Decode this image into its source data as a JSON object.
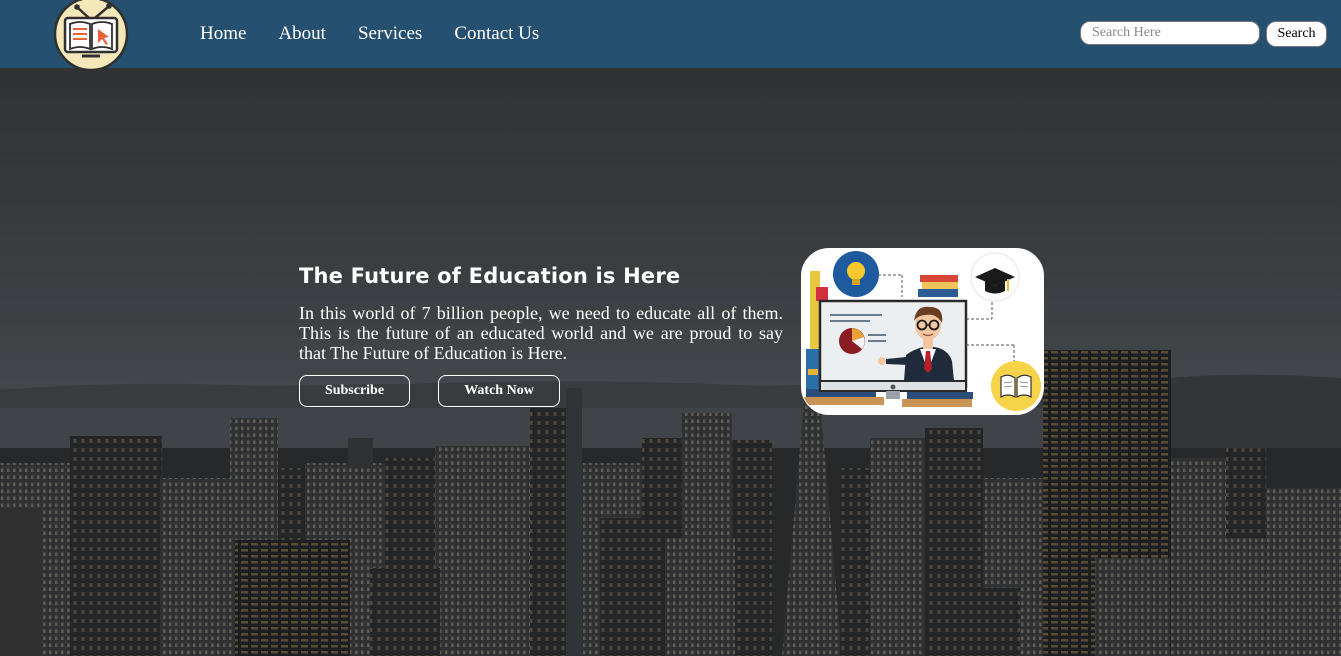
{
  "navbar": {
    "logo_icon": "education-tv-book-icon",
    "links": [
      "Home",
      "About",
      "Services",
      "Contact Us"
    ],
    "search": {
      "placeholder": "Search Here",
      "value": "",
      "button_label": "Search"
    },
    "colors": {
      "background": "#26506f",
      "text": "#ffffff"
    }
  },
  "hero": {
    "title": "The Future of Education is Here",
    "description": "In this world of 7 billion people, we need to educate all of them. This is the future of an educated world and we are proud to say that The Future of Education is Here.",
    "buttons": {
      "subscribe": "Subscribe",
      "watch_now": "Watch Now"
    },
    "background": "dark-city-skyline-image",
    "illustration": "teacher-presenting-online-class-illustration",
    "illustration_icons": [
      "lightbulb-icon",
      "graduation-cap-icon",
      "books-icon",
      "open-book-icon",
      "pie-chart-icon"
    ]
  }
}
